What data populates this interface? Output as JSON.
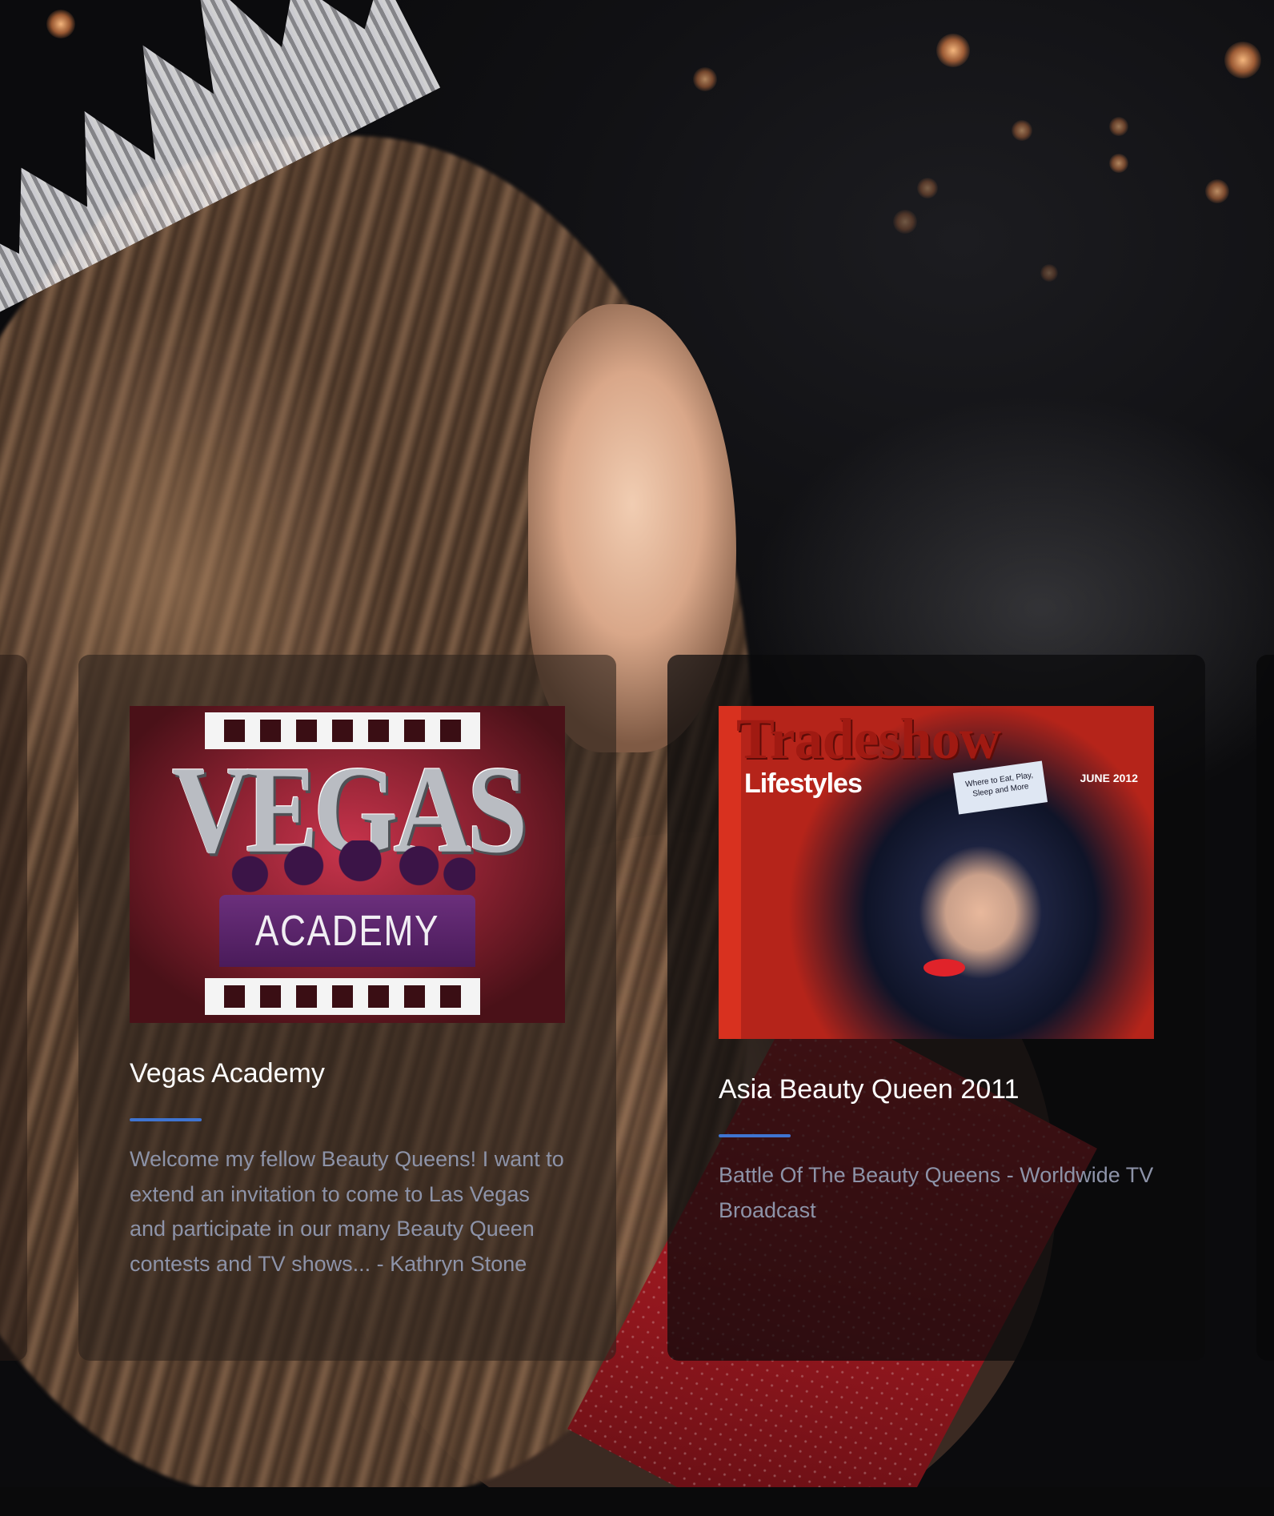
{
  "cards": [
    {
      "title": "Vegas Academy",
      "description": "Welcome my fellow Beauty Queens! I want to extend an invitation to come to Las Vegas and participate in our many Beauty Queen contests and TV shows... - Kathryn Stone",
      "image": {
        "top_word": "VEGAS",
        "bottom_word": "ACADEMY"
      }
    },
    {
      "title": "Asia Beauty Queen 2011",
      "description": "Battle Of The Beauty Queens - Worldwide TV Broadcast",
      "image": {
        "masthead": "Tradeshow",
        "subtitle": "Lifestyles",
        "date": "JUNE 2012",
        "badge": "Where to Eat, Play, Sleep and More"
      }
    }
  ],
  "colors": {
    "accent": "#3f74d1",
    "card_text": "#8d93a8",
    "title_text": "#ffffff"
  }
}
